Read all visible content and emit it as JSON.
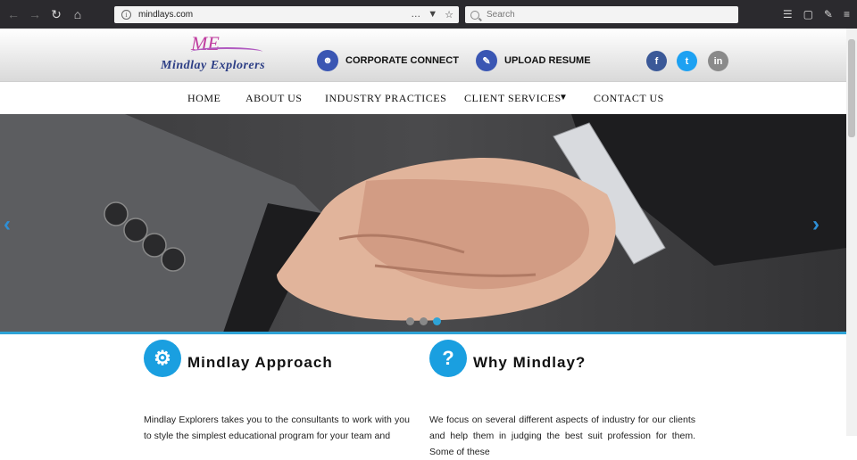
{
  "browser": {
    "url": "mindlays.com",
    "search_placeholder": "Search"
  },
  "header": {
    "logo_mark": "ME",
    "logo_name": "Mindlay Explorers",
    "links": [
      {
        "label": "CORPORATE CONNECT",
        "icon": "people-icon"
      },
      {
        "label": "UPLOAD RESUME",
        "icon": "pencil-icon"
      }
    ],
    "social": [
      {
        "label": "f",
        "icon": "facebook-icon",
        "color": "#3b5998"
      },
      {
        "label": "t",
        "icon": "twitter-icon",
        "color": "#1da1f2"
      },
      {
        "label": "in",
        "icon": "linkedin-icon",
        "color": "#8a8a8a"
      }
    ]
  },
  "nav": {
    "items": [
      "HOME",
      "ABOUT US",
      "INDUSTRY PRACTICES",
      "CLIENT SERVICES",
      "CONTACT US"
    ]
  },
  "hero": {
    "slides": 3,
    "active_slide": 3
  },
  "sections": [
    {
      "title": "Mindlay Approach",
      "icon": "gear-icon",
      "body": "Mindlay Explorers takes you to the consultants to work with you to style the simplest educational program for your team and"
    },
    {
      "title": "Why Mindlay?",
      "icon": "question-icon",
      "body": "We focus on several different aspects of industry for our clients and help them in judging the best suit profession for them. Some of these"
    }
  ],
  "colors": {
    "accent": "#1a9fe0",
    "hero_bg": "#3d3d3f",
    "header_link_icon": "#3a56b3"
  }
}
